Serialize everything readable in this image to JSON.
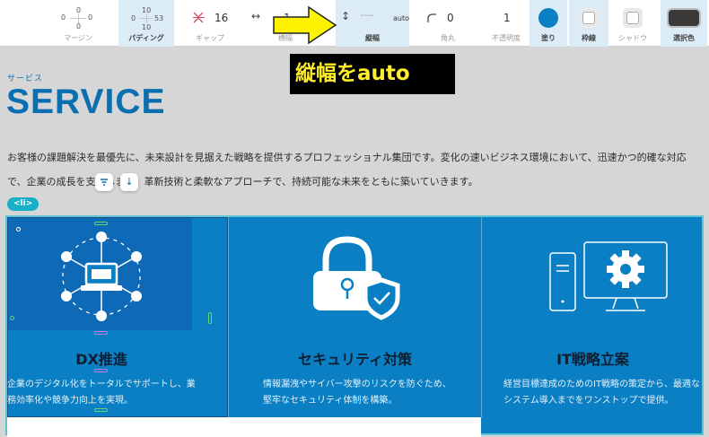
{
  "toolbar": {
    "margin": {
      "label": "マージン",
      "top": "0",
      "left": "0",
      "right": "0",
      "bottom": "0"
    },
    "padding": {
      "label": "パディング",
      "top": "10",
      "left": "0",
      "right": "53",
      "bottom": "10"
    },
    "gap": {
      "label": "ギャップ",
      "value": "16"
    },
    "width": {
      "label": "横幅",
      "value": "1"
    },
    "height": {
      "label": "縦幅",
      "value": "----",
      "unit": "auto"
    },
    "radius": {
      "label": "角丸",
      "value": "0"
    },
    "opacity": {
      "label": "不透明度",
      "value": "1"
    },
    "fill": {
      "label": "塗り",
      "color": "#0b7fc3"
    },
    "border": {
      "label": "枠線"
    },
    "shadow": {
      "label": "シャドウ"
    },
    "selected_color": {
      "label": "選択色",
      "color": "#3a3a3a"
    }
  },
  "callout": {
    "text": "縦幅をauto"
  },
  "page": {
    "eyebrow": "サービス",
    "heading": "SERVICE",
    "lead": "お客様の課題解決を最優先に、未来設計を見据えた戦略を提供するプロフェッショナル集団です。変化の速いビジネス環境において、迅速かつ的確な対応で、企業の成長を支援します。革新技術と柔軟なアプローチで、持続可能な未来をともに築いていきます。",
    "tag": "<li>",
    "accent": "#0a6fb0"
  },
  "cards": [
    {
      "title": "DX推進",
      "body": "企業のデジタル化をトータルでサポートし、業務効率化や競争力向上を実現。",
      "icon": "network-laptop-icon"
    },
    {
      "title": "セキュリティ対策",
      "body": "情報漏洩やサイバー攻撃のリスクを防ぐため、堅牢なセキュリティ体制を構築。",
      "icon": "padlock-shield-icon"
    },
    {
      "title": "IT戦略立案",
      "body": "経営目標達成のためのIT戦略の策定から、最適なシステム導入までをワンストップで提供。",
      "icon": "computer-gear-icon"
    }
  ]
}
